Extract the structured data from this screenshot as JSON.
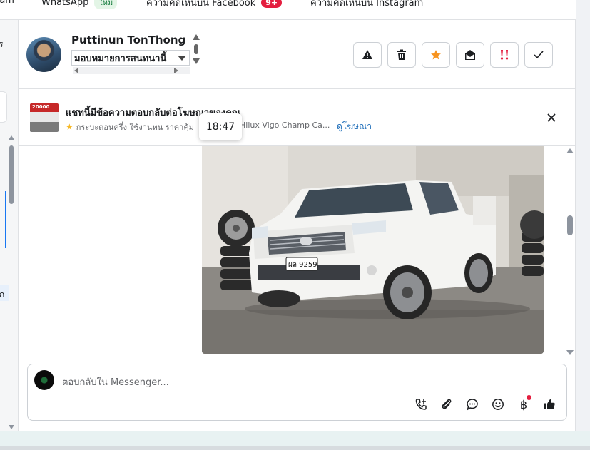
{
  "tabs": {
    "frag_left": "ram",
    "whatsapp": "WhatsApp",
    "new_badge": "ใหม่",
    "facebook_comments": "ความคิดเห็นบน Facebook",
    "facebook_count": "9+",
    "instagram_comments": "ความคิดเห็นบน Instagram"
  },
  "left_strip": {
    "frag_top": "ร",
    "frag_mid": "ก"
  },
  "conversation": {
    "contact_name": "Puttinun TonThong",
    "assign_label": "มอบหมายการสนทนานี้"
  },
  "actions": [
    {
      "name": "spam-icon",
      "label": "Report spam"
    },
    {
      "name": "trash-icon",
      "label": "Delete"
    },
    {
      "name": "star-icon",
      "label": "Star"
    },
    {
      "name": "mark-unread-icon",
      "label": "Mark unread"
    },
    {
      "name": "follow-up-icon",
      "label": "Follow up"
    },
    {
      "name": "done-icon",
      "label": "Done"
    }
  ],
  "ad_banner": {
    "title": "แชทนี้มีข้อความตอบกลับต่อโฆษณาของคุณ",
    "subtitle_start": "กระบะตอนครึ่ง ใช้งานทน ราคาคุ้ม",
    "subtitle_end": "Hilux Vigo Champ Ca...",
    "link": "ดูโฆษณา",
    "thumb_price": "20000"
  },
  "timestamp_tooltip": "18:47",
  "message_image": {
    "plate_text": "ผล 9259"
  },
  "composer": {
    "placeholder": "ตอบกลับใน Messenger..."
  },
  "colors": {
    "accent": "#1877f2",
    "star": "#f7931e",
    "follow_up": "#e41e3f",
    "link": "#1a6bb8"
  }
}
